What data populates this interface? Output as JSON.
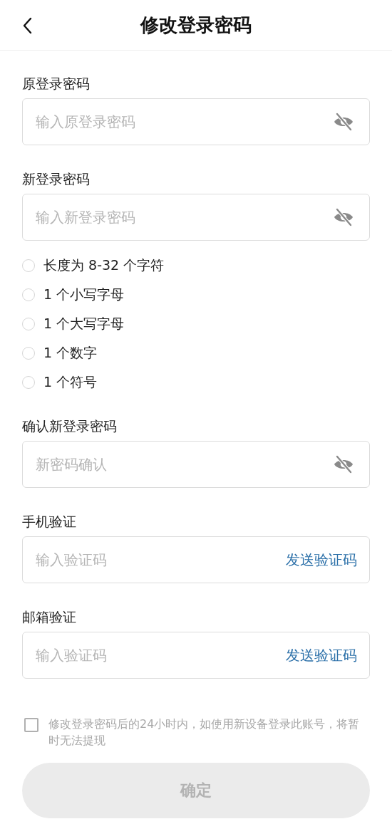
{
  "header": {
    "title": "修改登录密码"
  },
  "sections": [
    {
      "kind": "password_field",
      "label": "原登录密码",
      "placeholder": "输入原登录密码"
    },
    {
      "kind": "password_field",
      "label": "新登录密码",
      "placeholder": "输入新登录密码"
    },
    {
      "kind": "rules",
      "items": [
        {
          "text": "长度为 8-32 个字符",
          "checked": false
        },
        {
          "text": "1 个小写字母",
          "checked": false
        },
        {
          "text": "1 个大写字母",
          "checked": false
        },
        {
          "text": "1 个数字",
          "checked": false
        },
        {
          "text": "1 个符号",
          "checked": false
        }
      ]
    },
    {
      "kind": "password_field",
      "label": "确认新登录密码",
      "placeholder": "新密码确认"
    },
    {
      "kind": "code_field",
      "label": "手机验证",
      "placeholder": "输入验证码",
      "action": "发送验证码"
    },
    {
      "kind": "code_field",
      "label": "邮箱验证",
      "placeholder": "输入验证码",
      "action": "发送验证码"
    }
  ],
  "agreement": {
    "checked": false,
    "text": "修改登录密码后的24小时内，如使用新设备登录此账号，将暂时无法提现"
  },
  "submit": {
    "label": "确定",
    "disabled": true
  }
}
